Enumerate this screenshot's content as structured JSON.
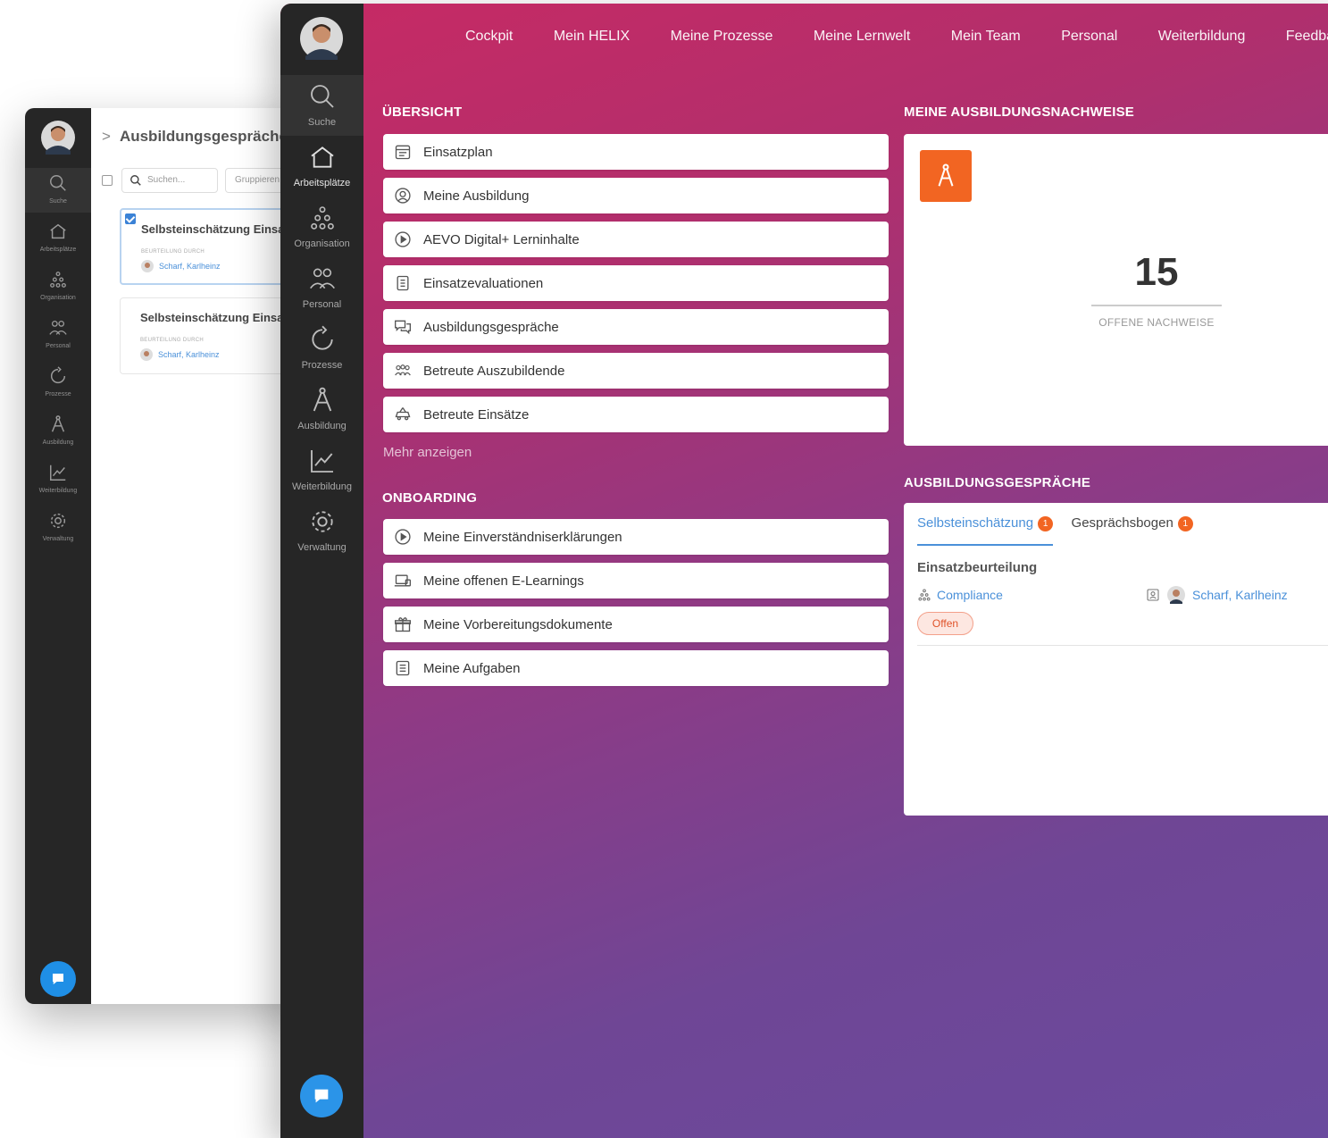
{
  "back_window": {
    "breadcrumb": "Ausbildungsgespräche",
    "search_placeholder": "Suchen...",
    "group_label": "Gruppieren",
    "nav": [
      {
        "label": "Suche",
        "icon": "search-icon"
      },
      {
        "label": "Arbeitsplätze",
        "icon": "home-icon"
      },
      {
        "label": "Organisation",
        "icon": "org-icon"
      },
      {
        "label": "Personal",
        "icon": "people-icon"
      },
      {
        "label": "Prozesse",
        "icon": "cycle-icon"
      },
      {
        "label": "Ausbildung",
        "icon": "compass-icon"
      },
      {
        "label": "Weiterbildung",
        "icon": "chart-icon"
      },
      {
        "label": "Verwaltung",
        "icon": "gear-icon"
      }
    ],
    "cards": [
      {
        "title": "Selbsteinschätzung Einsatzbeurteilung",
        "sub": "BEURTEILUNG DURCH",
        "person": "Scharf, Karlheinz"
      },
      {
        "title": "Selbsteinschätzung Einsatzbeurteilung",
        "sub": "BEURTEILUNG DURCH",
        "person": "Scharf, Karlheinz"
      }
    ]
  },
  "front_window": {
    "rail": [
      {
        "label": "Suche",
        "icon": "search-icon"
      },
      {
        "label": "Arbeitsplätze",
        "icon": "home-icon"
      },
      {
        "label": "Organisation",
        "icon": "org-icon"
      },
      {
        "label": "Personal",
        "icon": "people-icon"
      },
      {
        "label": "Prozesse",
        "icon": "cycle-icon"
      },
      {
        "label": "Ausbildung",
        "icon": "compass-icon"
      },
      {
        "label": "Weiterbildung",
        "icon": "chart-icon"
      },
      {
        "label": "Verwaltung",
        "icon": "gear-icon"
      }
    ],
    "topnav": [
      "Cockpit",
      "Mein HELIX",
      "Meine Prozesse",
      "Meine Lernwelt",
      "Mein Team",
      "Personal",
      "Weiterbildung",
      "Feedba"
    ],
    "overview": {
      "title": "ÜBERSICHT",
      "items": [
        {
          "label": "Einsatzplan",
          "icon": "calendar-icon"
        },
        {
          "label": "Meine Ausbildung",
          "icon": "user-circle-icon"
        },
        {
          "label": "AEVO Digital+ Lerninhalte",
          "icon": "play-icon"
        },
        {
          "label": "Einsatzevaluationen",
          "icon": "clipboard-icon"
        },
        {
          "label": "Ausbildungsgespräche",
          "icon": "chat-bubbles-icon"
        },
        {
          "label": "Betreute Auszubildende",
          "icon": "group-icon"
        },
        {
          "label": "Betreute Einsätze",
          "icon": "car-icon"
        }
      ],
      "more": "Mehr anzeigen"
    },
    "onboarding": {
      "title": "ONBOARDING",
      "items": [
        {
          "label": "Meine Einverständniserklärungen",
          "icon": "play-icon"
        },
        {
          "label": "Meine offenen E-Learnings",
          "icon": "laptop-icon"
        },
        {
          "label": "Meine Vorbereitungsdokumente",
          "icon": "gift-icon"
        },
        {
          "label": "Meine Aufgaben",
          "icon": "list-icon"
        }
      ]
    },
    "nachweise": {
      "title": "MEINE AUSBILDUNGSNACHWEISE",
      "count": "15",
      "count_label": "OFFENE NACHWEISE",
      "accent": "#f26522"
    },
    "gespraeche": {
      "title": "AUSBILDUNGSGESPRÄCHE",
      "tabs": [
        {
          "label": "Selbsteinschätzung",
          "badge": "1",
          "active": true
        },
        {
          "label": "Gesprächsbogen",
          "badge": "1",
          "active": false
        }
      ],
      "item": {
        "heading": "Einsatzbeurteilung",
        "link": "Compliance",
        "person": "Scharf, Karlheinz",
        "status": "Offen"
      }
    }
  }
}
